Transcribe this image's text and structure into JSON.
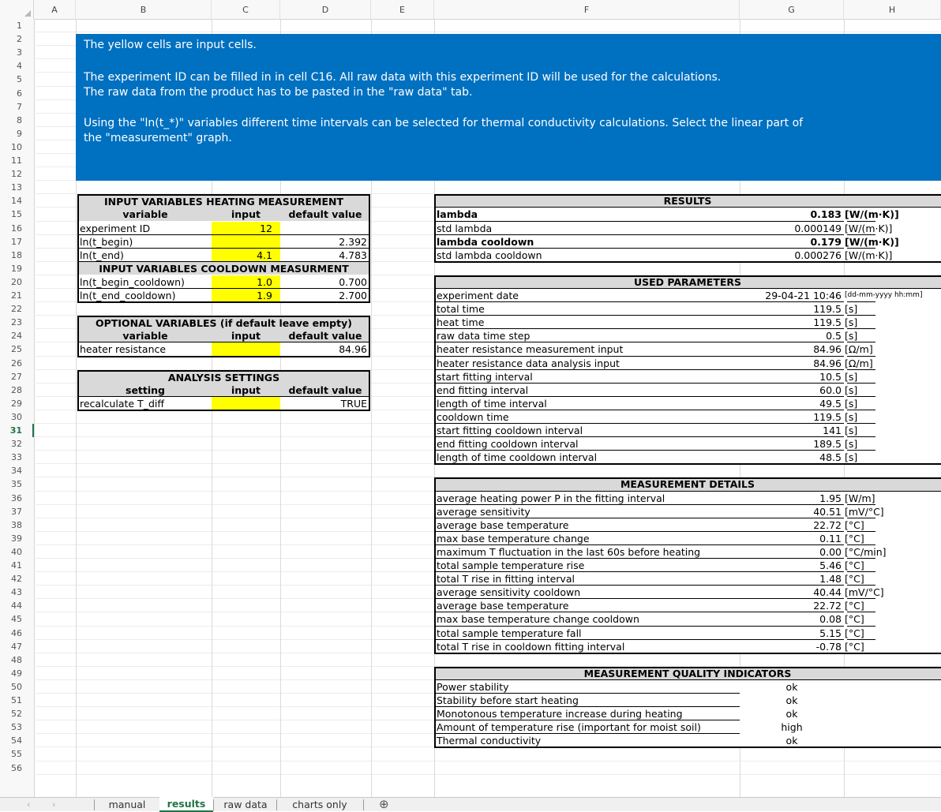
{
  "columns": [
    "A",
    "B",
    "C",
    "D",
    "E",
    "F",
    "G",
    "H"
  ],
  "rows": [
    "1",
    "2",
    "3",
    "4",
    "5",
    "6",
    "7",
    "8",
    "9",
    "10",
    "11",
    "12",
    "13",
    "14",
    "15",
    "16",
    "17",
    "18",
    "19",
    "20",
    "21",
    "22",
    "23",
    "24",
    "25",
    "26",
    "27",
    "28",
    "29",
    "30",
    "31",
    "32",
    "33",
    "34",
    "35",
    "36",
    "37",
    "38",
    "39",
    "40",
    "41",
    "42",
    "43",
    "44",
    "45",
    "46",
    "47",
    "48",
    "49",
    "50",
    "51",
    "52",
    "53",
    "54",
    "55",
    "56"
  ],
  "selected_row": "31",
  "banner": {
    "line1": "The yellow cells are input cells.",
    "line2": "The experiment ID can be filled in in cell C16. All raw data with this experiment ID will be used for the calculations.",
    "line3": "The raw data from the product has to be pasted in the \"raw data\" tab.",
    "line4": "Using the \"ln(t_*)\" variables different time intervals can be selected for thermal conductivity calculations. Select the linear part of",
    "line5": "the \"measurement\" graph."
  },
  "heating": {
    "title": "INPUT VARIABLES HEATING MEASUREMENT",
    "col_variable": "variable",
    "col_input": "input",
    "col_default": "default value",
    "rows": [
      {
        "name": "experiment ID",
        "input": "12",
        "default": ""
      },
      {
        "name": "ln(t_begin)",
        "input": "",
        "default": "2.392"
      },
      {
        "name": "ln(t_end)",
        "input": "4.1",
        "default": "4.783"
      }
    ]
  },
  "cooldown": {
    "title": "INPUT VARIABLES COOLDOWN MEASURMENT",
    "rows": [
      {
        "name": "ln(t_begin_cooldown)",
        "input": "1.0",
        "default": "0.700"
      },
      {
        "name": "ln(t_end_cooldown)",
        "input": "1.9",
        "default": "2.700"
      }
    ]
  },
  "optional": {
    "title": "OPTIONAL VARIABLES (if default leave empty)",
    "col_variable": "variable",
    "col_input": "input",
    "col_default": "default value",
    "rows": [
      {
        "name": "heater resistance",
        "input": "",
        "default": "84.96"
      }
    ]
  },
  "analysis": {
    "title": "ANALYSIS SETTINGS",
    "col_setting": "setting",
    "col_input": "input",
    "col_default": "default value",
    "rows": [
      {
        "name": "recalculate T_diff",
        "input": "",
        "default": "TRUE"
      }
    ]
  },
  "results": {
    "title": "RESULTS",
    "rows": [
      {
        "name": "lambda",
        "value": "0.183",
        "unit": "[W/(m·K)]",
        "bold": true
      },
      {
        "name": "std lambda",
        "value": "0.000149",
        "unit": "[W/(m·K)]",
        "bold": false
      },
      {
        "name": "lambda cooldown",
        "value": "0.179",
        "unit": "[W/(m·K)]",
        "bold": true
      },
      {
        "name": "std lambda cooldown",
        "value": "0.000276",
        "unit": "[W/(m·K)]",
        "bold": false
      }
    ]
  },
  "used_parameters": {
    "title": "USED PARAMETERS",
    "rows": [
      {
        "name": "experiment date",
        "value": "29-04-21 10:46",
        "unit": "[dd-mm-yyyy hh:mm]"
      },
      {
        "name": "total time",
        "value": "119.5",
        "unit": "[s]"
      },
      {
        "name": "heat time",
        "value": "119.5",
        "unit": "[s]"
      },
      {
        "name": "raw data time step",
        "value": "0.5",
        "unit": "[s]"
      },
      {
        "name": "heater resistance measurement input",
        "value": "84.96",
        "unit": "[Ω/m]"
      },
      {
        "name": "heater resistance data analysis input",
        "value": "84.96",
        "unit": "[Ω/m]"
      },
      {
        "name": "start fitting interval",
        "value": "10.5",
        "unit": "[s]"
      },
      {
        "name": "end fitting interval",
        "value": "60.0",
        "unit": "[s]"
      },
      {
        "name": "length of time interval",
        "value": "49.5",
        "unit": "[s]"
      },
      {
        "name": "cooldown time",
        "value": "119.5",
        "unit": "[s]"
      },
      {
        "name": "start fitting cooldown interval",
        "value": "141",
        "unit": "[s]"
      },
      {
        "name": "end fitting cooldown interval",
        "value": "189.5",
        "unit": "[s]"
      },
      {
        "name": "length of time cooldown interval",
        "value": "48.5",
        "unit": "[s]"
      }
    ]
  },
  "measurement_details": {
    "title": "MEASUREMENT DETAILS",
    "rows": [
      {
        "name": "average heating power P in the fitting interval",
        "value": "1.95",
        "unit": "[W/m]"
      },
      {
        "name": "average sensitivity",
        "value": "40.51",
        "unit": "[mV/°C]"
      },
      {
        "name": "average base temperature",
        "value": "22.72",
        "unit": "[°C]"
      },
      {
        "name": "max base temperature change",
        "value": "0.11",
        "unit": "[°C]"
      },
      {
        "name": "maximum T fluctuation in the last 60s before heating",
        "value": "0.00",
        "unit": "[°C/min]"
      },
      {
        "name": "total sample temperature rise",
        "value": "5.46",
        "unit": "[°C]"
      },
      {
        "name": "total T rise in fitting interval",
        "value": "1.48",
        "unit": "[°C]"
      },
      {
        "name": "average sensitivity cooldown",
        "value": "40.44",
        "unit": "[mV/°C]"
      },
      {
        "name": "average base temperature",
        "value": "22.72",
        "unit": "[°C]"
      },
      {
        "name": "max base temperature change cooldown",
        "value": "0.08",
        "unit": "[°C]"
      },
      {
        "name": "total sample temperature fall",
        "value": "5.15",
        "unit": "[°C]"
      },
      {
        "name": "total T rise in cooldown fitting interval",
        "value": "-0.78",
        "unit": "[°C]"
      }
    ]
  },
  "quality": {
    "title": "MEASUREMENT QUALITY INDICATORS",
    "rows": [
      {
        "name": "Power stability",
        "value": "ok"
      },
      {
        "name": "Stability before start heating",
        "value": "ok"
      },
      {
        "name": "Monotonous temperature increase during heating",
        "value": "ok"
      },
      {
        "name": "Amount of temperature rise (important for moist soil)",
        "value": "high"
      },
      {
        "name": "Thermal conductivity",
        "value": "ok"
      }
    ]
  },
  "tabs": {
    "prev_icon": "‹",
    "next_icon": "›",
    "items": [
      "manual",
      "results",
      "raw data",
      "charts only"
    ],
    "active": "results",
    "add_icon": "⊕"
  },
  "colors": {
    "banner": "#0070c0",
    "input_cell": "#ffff00",
    "header_band": "#d9d9d9",
    "accent": "#217346"
  }
}
